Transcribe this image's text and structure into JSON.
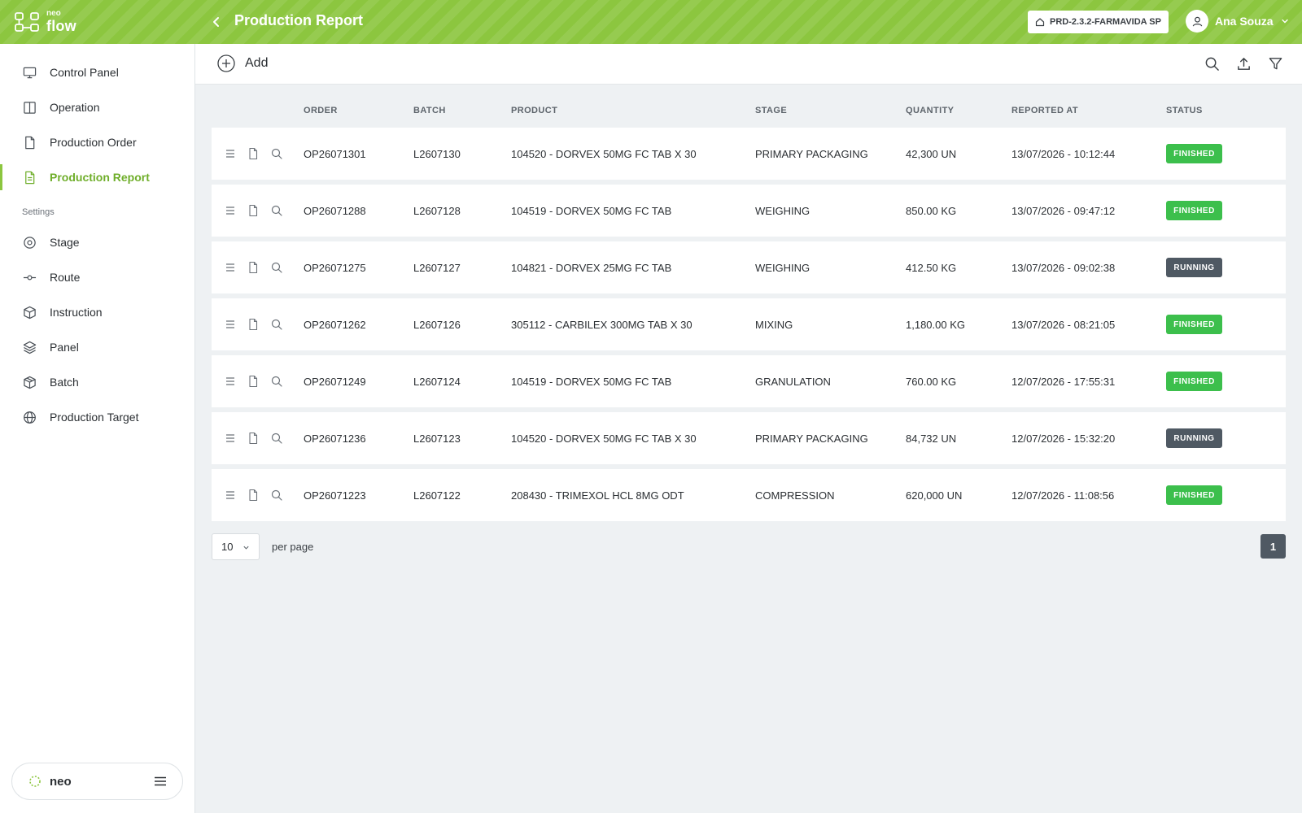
{
  "app": {
    "logo_top": "neo",
    "logo_bottom": "flow",
    "title": "Production Report"
  },
  "header": {
    "environment": "PRD-2.3.2-FARMAVIDA SP",
    "user_name": "Ana Souza"
  },
  "sidebar": {
    "items": [
      {
        "label": "Control Panel",
        "icon": "monitor-icon"
      },
      {
        "label": "Operation",
        "icon": "columns-icon"
      },
      {
        "label": "Production Order",
        "icon": "file-icon"
      },
      {
        "label": "Production Report",
        "icon": "file-text-icon",
        "active": true
      }
    ],
    "settings_label": "Settings",
    "settings_items": [
      {
        "label": "Stage",
        "icon": "target-icon"
      },
      {
        "label": "Route",
        "icon": "route-icon"
      },
      {
        "label": "Instruction",
        "icon": "cube-icon"
      },
      {
        "label": "Panel",
        "icon": "layers-icon"
      },
      {
        "label": "Batch",
        "icon": "package-icon"
      },
      {
        "label": "Production Target",
        "icon": "globe-icon"
      }
    ],
    "footer_label": "neo"
  },
  "toolbar": {
    "add_label": "Add"
  },
  "table": {
    "columns": [
      "ORDER",
      "BATCH",
      "PRODUCT",
      "STAGE",
      "QUANTITY",
      "REPORTED AT",
      "STATUS"
    ],
    "rows": [
      {
        "order": "OP26071301",
        "batch": "L2607130",
        "product": "104520 - DORVEX 50MG FC TAB X 30",
        "stage": "PRIMARY PACKAGING",
        "quantity": "42,300 UN",
        "reported_at": "13/07/2026 - 10:12:44",
        "status": "FINISHED"
      },
      {
        "order": "OP26071288",
        "batch": "L2607128",
        "product": "104519 - DORVEX 50MG FC TAB",
        "stage": "WEIGHING",
        "quantity": "850.00 KG",
        "reported_at": "13/07/2026 - 09:47:12",
        "status": "FINISHED"
      },
      {
        "order": "OP26071275",
        "batch": "L2607127",
        "product": "104821 - DORVEX 25MG FC TAB",
        "stage": "WEIGHING",
        "quantity": "412.50 KG",
        "reported_at": "13/07/2026 - 09:02:38",
        "status": "RUNNING"
      },
      {
        "order": "OP26071262",
        "batch": "L2607126",
        "product": "305112 - CARBILEX 300MG TAB X 30",
        "stage": "MIXING",
        "quantity": "1,180.00 KG",
        "reported_at": "13/07/2026 - 08:21:05",
        "status": "FINISHED"
      },
      {
        "order": "OP26071249",
        "batch": "L2607124",
        "product": "104519 - DORVEX 50MG FC TAB",
        "stage": "GRANULATION",
        "quantity": "760.00 KG",
        "reported_at": "12/07/2026 - 17:55:31",
        "status": "FINISHED"
      },
      {
        "order": "OP26071236",
        "batch": "L2607123",
        "product": "104520 - DORVEX 50MG FC TAB X 30",
        "stage": "PRIMARY PACKAGING",
        "quantity": "84,732 UN",
        "reported_at": "12/07/2026 - 15:32:20",
        "status": "RUNNING"
      },
      {
        "order": "OP26071223",
        "batch": "L2607122",
        "product": "208430 - TRIMEXOL HCL 8MG ODT",
        "stage": "COMPRESSION",
        "quantity": "620,000 UN",
        "reported_at": "12/07/2026 - 11:08:56",
        "status": "FINISHED"
      }
    ]
  },
  "pagination": {
    "per_page_value": "10",
    "per_page_label": "per page",
    "current_page": "1"
  },
  "colors": {
    "brand": "#8cc63f",
    "finished": "#3cbf4c",
    "running": "#4f5963",
    "active_text": "#6fae2a"
  }
}
